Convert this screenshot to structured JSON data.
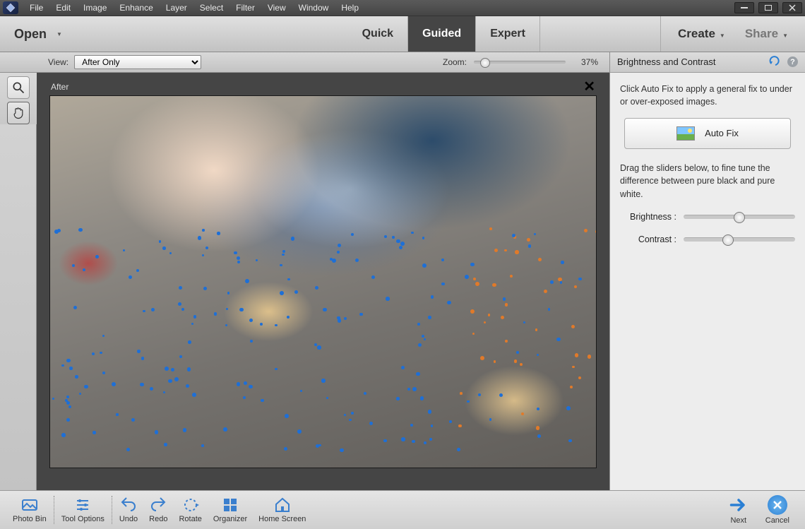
{
  "menubar": [
    "File",
    "Edit",
    "Image",
    "Enhance",
    "Layer",
    "Select",
    "Filter",
    "View",
    "Window",
    "Help"
  ],
  "modebar": {
    "open": "Open",
    "tabs": [
      "Quick",
      "Guided",
      "Expert"
    ],
    "active_tab": "Guided",
    "create": "Create",
    "share": "Share"
  },
  "optionbar": {
    "view_label": "View:",
    "view_value": "After Only",
    "zoom_label": "Zoom:",
    "zoom_value": "37%",
    "zoom_pos_pct": 8
  },
  "canvas": {
    "title": "After"
  },
  "panel": {
    "title": "Brightness and Contrast",
    "intro": "Click Auto Fix to apply a general fix to under or over-exposed images.",
    "autofix": "Auto Fix",
    "desc2": "Drag the sliders below, to fine tune the difference between pure black and pure white.",
    "sliders": {
      "brightness_label": "Brightness :",
      "brightness_pos_pct": 50,
      "contrast_label": "Contrast :",
      "contrast_pos_pct": 40
    }
  },
  "bottombar": {
    "photo_bin": "Photo Bin",
    "tool_options": "Tool Options",
    "undo": "Undo",
    "redo": "Redo",
    "rotate": "Rotate",
    "organizer": "Organizer",
    "home": "Home Screen",
    "next": "Next",
    "cancel": "Cancel"
  }
}
